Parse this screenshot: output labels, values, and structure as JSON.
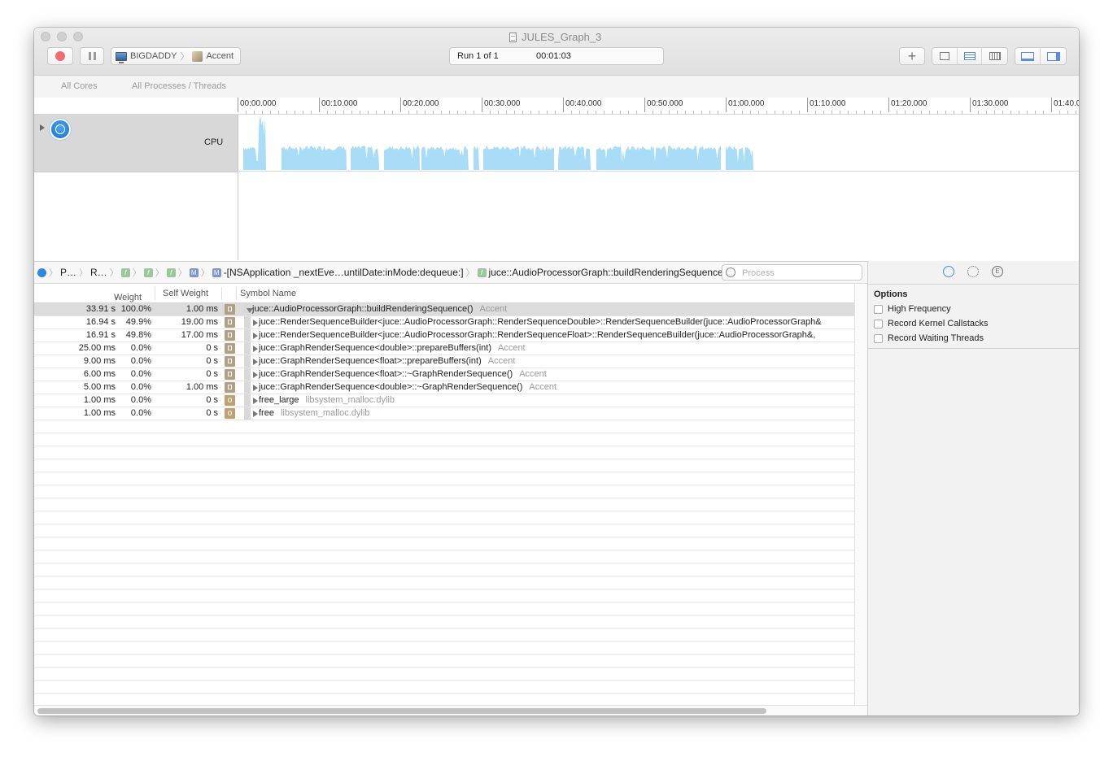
{
  "window": {
    "title": "JULES_Graph_3"
  },
  "toolbar": {
    "device": "BIGDADDY",
    "target": "Accent",
    "run_label": "Run 1 of 1",
    "elapsed": "00:01:03"
  },
  "strategy": {
    "cores": "All Cores",
    "processes": "All Processes / Threads"
  },
  "ruler": {
    "labels": [
      "00:00.000",
      "00:10.000",
      "00:20.000",
      "00:30.000",
      "00:40.000",
      "00:50.000",
      "01:00.000",
      "01:10.000",
      "01:20.000",
      "01:30.000",
      "01:40.0"
    ]
  },
  "track": {
    "name": "CPU"
  },
  "cpu_activity": {
    "color": "#a9dcf7",
    "duration_s": 63,
    "segments": [
      [
        0.3,
        3.1
      ],
      [
        5.0,
        13.0
      ],
      [
        13.5,
        17.0
      ],
      [
        17.6,
        22.0
      ],
      [
        22.2,
        28.0
      ],
      [
        28.6,
        29.3
      ],
      [
        29.8,
        38.5
      ],
      [
        39.0,
        43.0
      ],
      [
        43.7,
        59.0
      ],
      [
        59.6,
        63.0
      ]
    ]
  },
  "jumpbar": {
    "p": "P…",
    "r": "R…",
    "method": "-[NSApplication _nextEve…untilDate:inMode:dequeue:]",
    "function": "juce::AudioProcessorGraph::buildRenderingSequence()",
    "search_placeholder": "Process"
  },
  "columns": {
    "weight": "Weight",
    "self_weight": "Self Weight",
    "symbol": "Symbol Name"
  },
  "rows": [
    {
      "weight": "33.91 s",
      "pct": "100.0%",
      "self": "1.00 ms",
      "symbol": "juce::AudioProcessorGraph::buildRenderingSequence()",
      "lib": "Accent",
      "expanded": true,
      "lib_type": "app"
    },
    {
      "weight": "16.94 s",
      "pct": "49.9%",
      "self": "19.00 ms",
      "symbol": "juce::RenderSequenceBuilder<juce::AudioProcessorGraph::RenderSequenceDouble>::RenderSequenceBuilder(juce::AudioProcessorGraph&",
      "lib": "",
      "lib_type": "app"
    },
    {
      "weight": "16.91 s",
      "pct": "49.8%",
      "self": "17.00 ms",
      "symbol": "juce::RenderSequenceBuilder<juce::AudioProcessorGraph::RenderSequenceFloat>::RenderSequenceBuilder(juce::AudioProcessorGraph&,",
      "lib": "",
      "lib_type": "app"
    },
    {
      "weight": "25.00 ms",
      "pct": "0.0%",
      "self": "0 s",
      "symbol": "juce::GraphRenderSequence<double>::prepareBuffers(int)",
      "lib": "Accent",
      "lib_type": "app"
    },
    {
      "weight": "9.00 ms",
      "pct": "0.0%",
      "self": "0 s",
      "symbol": "juce::GraphRenderSequence<float>::prepareBuffers(int)",
      "lib": "Accent",
      "lib_type": "app"
    },
    {
      "weight": "6.00 ms",
      "pct": "0.0%",
      "self": "0 s",
      "symbol": "juce::GraphRenderSequence<float>::~GraphRenderSequence()",
      "lib": "Accent",
      "lib_type": "app"
    },
    {
      "weight": "5.00 ms",
      "pct": "0.0%",
      "self": "1.00 ms",
      "symbol": "juce::GraphRenderSequence<double>::~GraphRenderSequence()",
      "lib": "Accent",
      "lib_type": "app"
    },
    {
      "weight": "1.00 ms",
      "pct": "0.0%",
      "self": "0 s",
      "symbol": "free_large",
      "lib": "libsystem_malloc.dylib",
      "lib_type": "lib"
    },
    {
      "weight": "1.00 ms",
      "pct": "0.0%",
      "self": "0 s",
      "symbol": "free",
      "lib": "libsystem_malloc.dylib",
      "lib_type": "lib"
    }
  ],
  "inspector": {
    "title": "Options",
    "options": [
      {
        "label": "High Frequency",
        "checked": false
      },
      {
        "label": "Record Kernel Callstacks",
        "checked": false
      },
      {
        "label": "Record Waiting Threads",
        "checked": false
      }
    ]
  }
}
